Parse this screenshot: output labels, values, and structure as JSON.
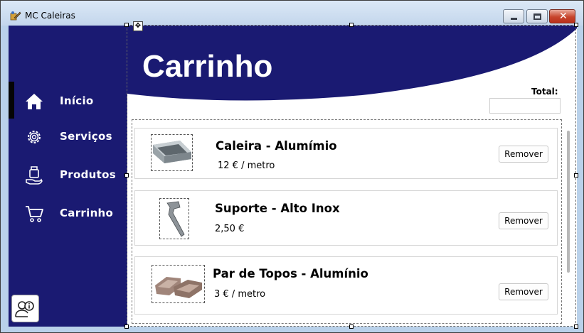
{
  "window": {
    "title": "MC Caleiras",
    "close_glyph": "✕"
  },
  "sidebar": {
    "items": [
      {
        "label": "Início",
        "icon": "home-icon"
      },
      {
        "label": "Serviços",
        "icon": "gear-icon"
      },
      {
        "label": "Produtos",
        "icon": "product-hand-icon"
      },
      {
        "label": "Carrinho",
        "icon": "cart-icon"
      }
    ],
    "info_icon": "user-info-icon"
  },
  "main": {
    "title": "Carrinho",
    "total_label": "Total:",
    "total_value": ""
  },
  "cart": {
    "remove_label": "Remover",
    "items": [
      {
        "name": "Caleira - Alumímio",
        "price": "12 € / metro"
      },
      {
        "name": "Suporte - Alto Inox",
        "price": "2,50 €"
      },
      {
        "name": "Par de Topos - Alumínio",
        "price": "3 € / metro"
      }
    ]
  },
  "colors": {
    "sidebar": "#1a1a72",
    "header": "#1a1a72"
  }
}
